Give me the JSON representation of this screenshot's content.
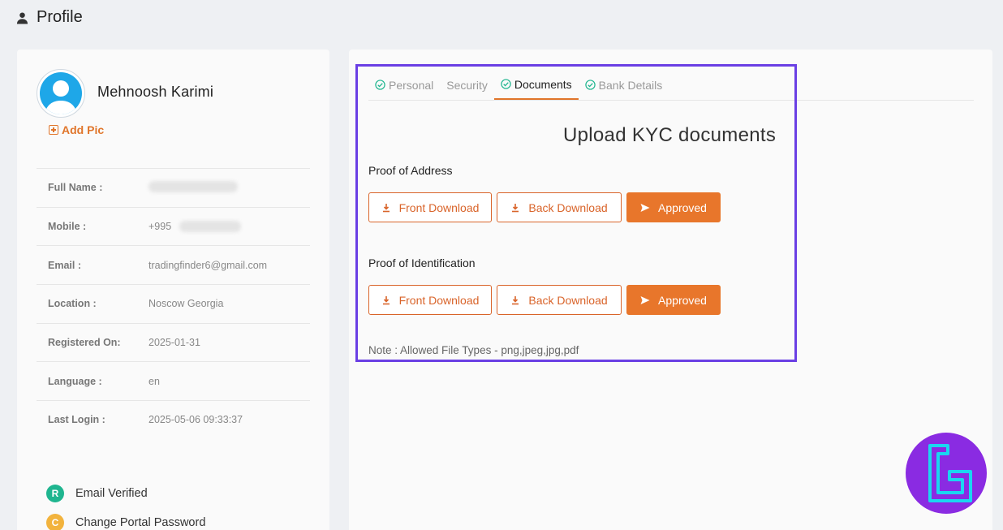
{
  "header": {
    "title": "Profile",
    "icon": "user-icon"
  },
  "profile": {
    "name": "Mehnoosh Karimi",
    "add_pic_label": "Add Pic",
    "fields": [
      {
        "label": "Full Name :",
        "value": ""
      },
      {
        "label": "Mobile :",
        "value": "+995"
      },
      {
        "label": "Email :",
        "value": "tradingfinder6@gmail.com"
      },
      {
        "label": "Location :",
        "value": "Noscow Georgia"
      },
      {
        "label": "Registered On:",
        "value": "2025-01-31"
      },
      {
        "label": "Language :",
        "value": "en"
      },
      {
        "label": "Last Login :",
        "value": "2025-05-06 09:33:37"
      }
    ],
    "status": [
      {
        "badge": "R",
        "label": "Email Verified",
        "color": "#1fb58f"
      },
      {
        "badge": "C",
        "label": "Change Portal Password",
        "color": "#f2b33d"
      }
    ]
  },
  "tabs": [
    {
      "label": "Personal",
      "checked": true
    },
    {
      "label": "Security",
      "checked": false
    },
    {
      "label": "Documents",
      "checked": true,
      "active": true
    },
    {
      "label": "Bank Details",
      "checked": true
    }
  ],
  "kyc": {
    "title": "Upload KYC documents",
    "sections": [
      {
        "label": "Proof of Address",
        "front": "Front Download",
        "back": "Back Download",
        "status": "Approved"
      },
      {
        "label": "Proof of Identification",
        "front": "Front Download",
        "back": "Back Download",
        "status": "Approved"
      }
    ],
    "note": "Note : Allowed File Types - png,jpeg,jpg,pdf"
  },
  "colors": {
    "accent": "#e8762b",
    "highlight": "#6a3fe4",
    "check": "#1fb58f"
  }
}
